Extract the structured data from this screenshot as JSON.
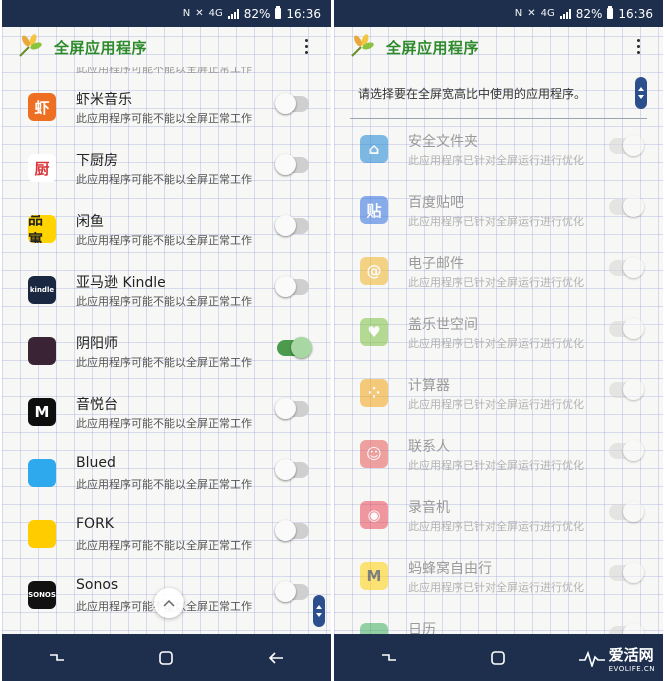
{
  "status_bar": {
    "net": "4G",
    "battery": "82%",
    "time": "16:36"
  },
  "app": {
    "title": "全屏应用程序"
  },
  "left_list": [
    {
      "name": "虾米音乐",
      "desc": "此应用程序可能不能以全屏正常工作",
      "icon": "xiami-music-icon",
      "glyph": "虾",
      "color": "#ee6f22",
      "toggle_on": false
    },
    {
      "name": "下厨房",
      "desc": "此应用程序可能不能以全屏正常工作",
      "icon": "xiachufang-icon",
      "glyph": "厨",
      "color": "#ffffff",
      "toggle_on": false
    },
    {
      "name": "闲鱼",
      "desc": "此应用程序可能不能以全屏正常工作",
      "icon": "xianyu-icon",
      "glyph": "品寓",
      "color": "#ffd400",
      "toggle_on": false
    },
    {
      "name": "亚马逊 Kindle",
      "desc": "此应用程序可能不能以全屏正常工作",
      "icon": "kindle-icon",
      "glyph": "kindle",
      "color": "#1a2740",
      "toggle_on": false
    },
    {
      "name": "阴阳师",
      "desc": "此应用程序可能不能以全屏正常工作",
      "icon": "yinyangshi-icon",
      "glyph": "",
      "color": "#3a2335",
      "toggle_on": true
    },
    {
      "name": "音悦台",
      "desc": "此应用程序可能不能以全屏正常工作",
      "icon": "yinyuetai-icon",
      "glyph": "M",
      "color": "#0e0e0e",
      "toggle_on": false
    },
    {
      "name": "Blued",
      "desc": "此应用程序可能不能以全屏正常工作",
      "icon": "blued-icon",
      "glyph": "",
      "color": "#2fa9ee",
      "toggle_on": false
    },
    {
      "name": "FORK",
      "desc": "此应用程序可能不能以全屏正常工作",
      "icon": "fork-icon",
      "glyph": "",
      "color": "#ffcc00",
      "toggle_on": false
    },
    {
      "name": "Sonos",
      "desc": "此应用程序可能不能以全屏正常工作",
      "icon": "sonos-icon",
      "glyph": "SONOS",
      "color": "#111111",
      "toggle_on": false
    }
  ],
  "right_panel": {
    "instruction": "请选择要在全屏宽高比中使用的应用程序。",
    "items": [
      {
        "name": "安全文件夹",
        "desc": "此应用程序已针对全屏运行进行优化",
        "icon": "secure-folder-icon",
        "glyph": "⌂",
        "color": "#1a85d6"
      },
      {
        "name": "百度贴吧",
        "desc": "此应用程序已针对全屏运行进行优化",
        "icon": "baidu-tieba-icon",
        "glyph": "贴",
        "color": "#2f6fe0"
      },
      {
        "name": "电子邮件",
        "desc": "此应用程序已针对全屏运行进行优化",
        "icon": "email-icon",
        "glyph": "@",
        "color": "#f0b429"
      },
      {
        "name": "盖乐世空间",
        "desc": "此应用程序已针对全屏运行进行优化",
        "icon": "galaxy-space-icon",
        "glyph": "♥",
        "color": "#7cc242"
      },
      {
        "name": "计算器",
        "desc": "此应用程序已针对全屏运行进行优化",
        "icon": "calculator-icon",
        "glyph": "⁘",
        "color": "#f2a516"
      },
      {
        "name": "联系人",
        "desc": "此应用程序已针对全屏运行进行优化",
        "icon": "contacts-icon",
        "glyph": "☺",
        "color": "#e75a5a"
      },
      {
        "name": "录音机",
        "desc": "此应用程序已针对全屏运行进行优化",
        "icon": "voice-recorder-icon",
        "glyph": "◉",
        "color": "#e9475a"
      },
      {
        "name": "蚂蜂窝自由行",
        "desc": "此应用程序已针对全屏运行进行优化",
        "icon": "mafengwo-icon",
        "glyph": "M",
        "color": "#ffd20a"
      },
      {
        "name": "日历",
        "desc": "",
        "icon": "calendar-icon",
        "glyph": "",
        "color": "#3fae5c"
      }
    ]
  },
  "watermark": {
    "text": "爱活网",
    "sub": "EVOLIFE.CN"
  }
}
